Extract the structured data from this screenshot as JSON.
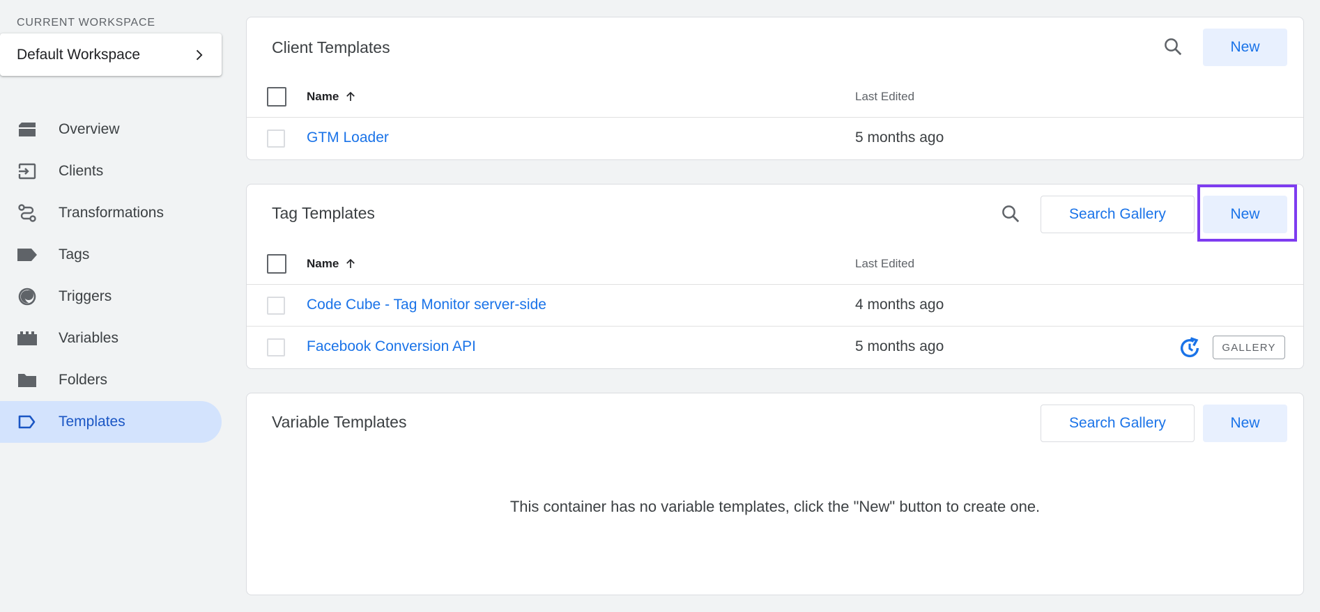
{
  "sidebar": {
    "workspace_label": "CURRENT WORKSPACE",
    "workspace_name": "Default Workspace",
    "items": [
      {
        "label": "Overview",
        "icon": "overview-icon"
      },
      {
        "label": "Clients",
        "icon": "clients-icon"
      },
      {
        "label": "Transformations",
        "icon": "transformations-icon"
      },
      {
        "label": "Tags",
        "icon": "tag-icon"
      },
      {
        "label": "Triggers",
        "icon": "trigger-icon"
      },
      {
        "label": "Variables",
        "icon": "variables-icon"
      },
      {
        "label": "Folders",
        "icon": "folder-icon"
      },
      {
        "label": "Templates",
        "icon": "template-icon",
        "active": true
      }
    ]
  },
  "client_templates": {
    "title": "Client Templates",
    "new_label": "New",
    "columns": {
      "name": "Name",
      "last_edited": "Last Edited"
    },
    "rows": [
      {
        "name": "GTM Loader",
        "last_edited": "5 months ago"
      }
    ]
  },
  "tag_templates": {
    "title": "Tag Templates",
    "search_gallery_label": "Search Gallery",
    "new_label": "New",
    "columns": {
      "name": "Name",
      "last_edited": "Last Edited"
    },
    "rows": [
      {
        "name": "Code Cube - Tag Monitor server-side",
        "last_edited": "4 months ago"
      },
      {
        "name": "Facebook Conversion API",
        "last_edited": "5 months ago",
        "badge": "GALLERY",
        "has_update": true
      }
    ]
  },
  "variable_templates": {
    "title": "Variable Templates",
    "search_gallery_label": "Search Gallery",
    "new_label": "New",
    "empty_message": "This container has no variable templates, click the \"New\" button to create one."
  },
  "colors": {
    "accent": "#1a73e8",
    "active_nav_bg": "#d3e3fd",
    "highlight_border": "#7e3cf0"
  }
}
